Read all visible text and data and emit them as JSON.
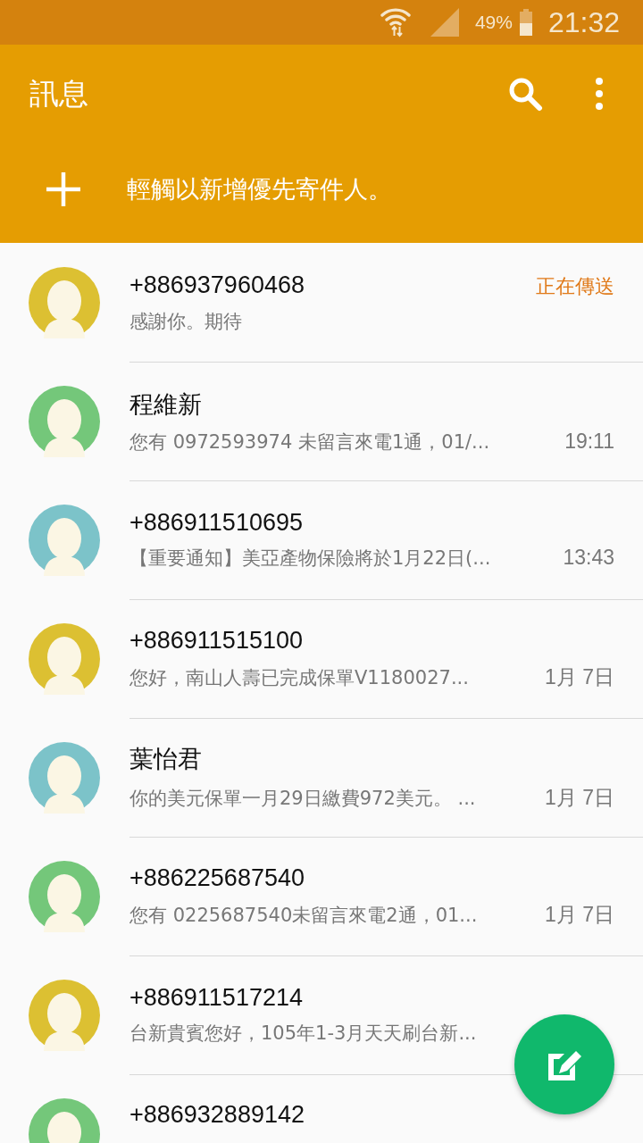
{
  "status_bar": {
    "battery": "49%",
    "time": "21:32"
  },
  "app_bar": {
    "title": "訊息",
    "priority_hint": "輕觸以新增優先寄件人。"
  },
  "conversations": [
    {
      "name": "+886937960468",
      "preview": "感謝你。期待",
      "status": "正在傳送",
      "color": "#dcc032"
    },
    {
      "name": "程維新",
      "preview": "您有 0972593974 未留言來電1通，01/...",
      "time": "19:11",
      "color": "#74c77a"
    },
    {
      "name": "+886911510695",
      "preview": "【重要通知】美亞產物保險將於1月22日(...",
      "time": "13:43",
      "color": "#7cc3c9"
    },
    {
      "name": "+886911515100",
      "preview": "您好，南山人壽已完成保單V1180027...",
      "time": "1月 7日",
      "color": "#dcc032"
    },
    {
      "name": "葉怡君",
      "preview": "你的美元保單一月29日繳費972美元。 ...",
      "time": "1月 7日",
      "color": "#7cc3c9"
    },
    {
      "name": "+886225687540",
      "preview": "您有 0225687540未留言來電2通，01...",
      "time": "1月 7日",
      "color": "#74c77a"
    },
    {
      "name": "+886911517214",
      "preview": "台新貴賓您好，105年1-3月天天刷台新...",
      "color": "#dcc032"
    },
    {
      "name": "+886932889142",
      "color": "#74c77a"
    }
  ]
}
